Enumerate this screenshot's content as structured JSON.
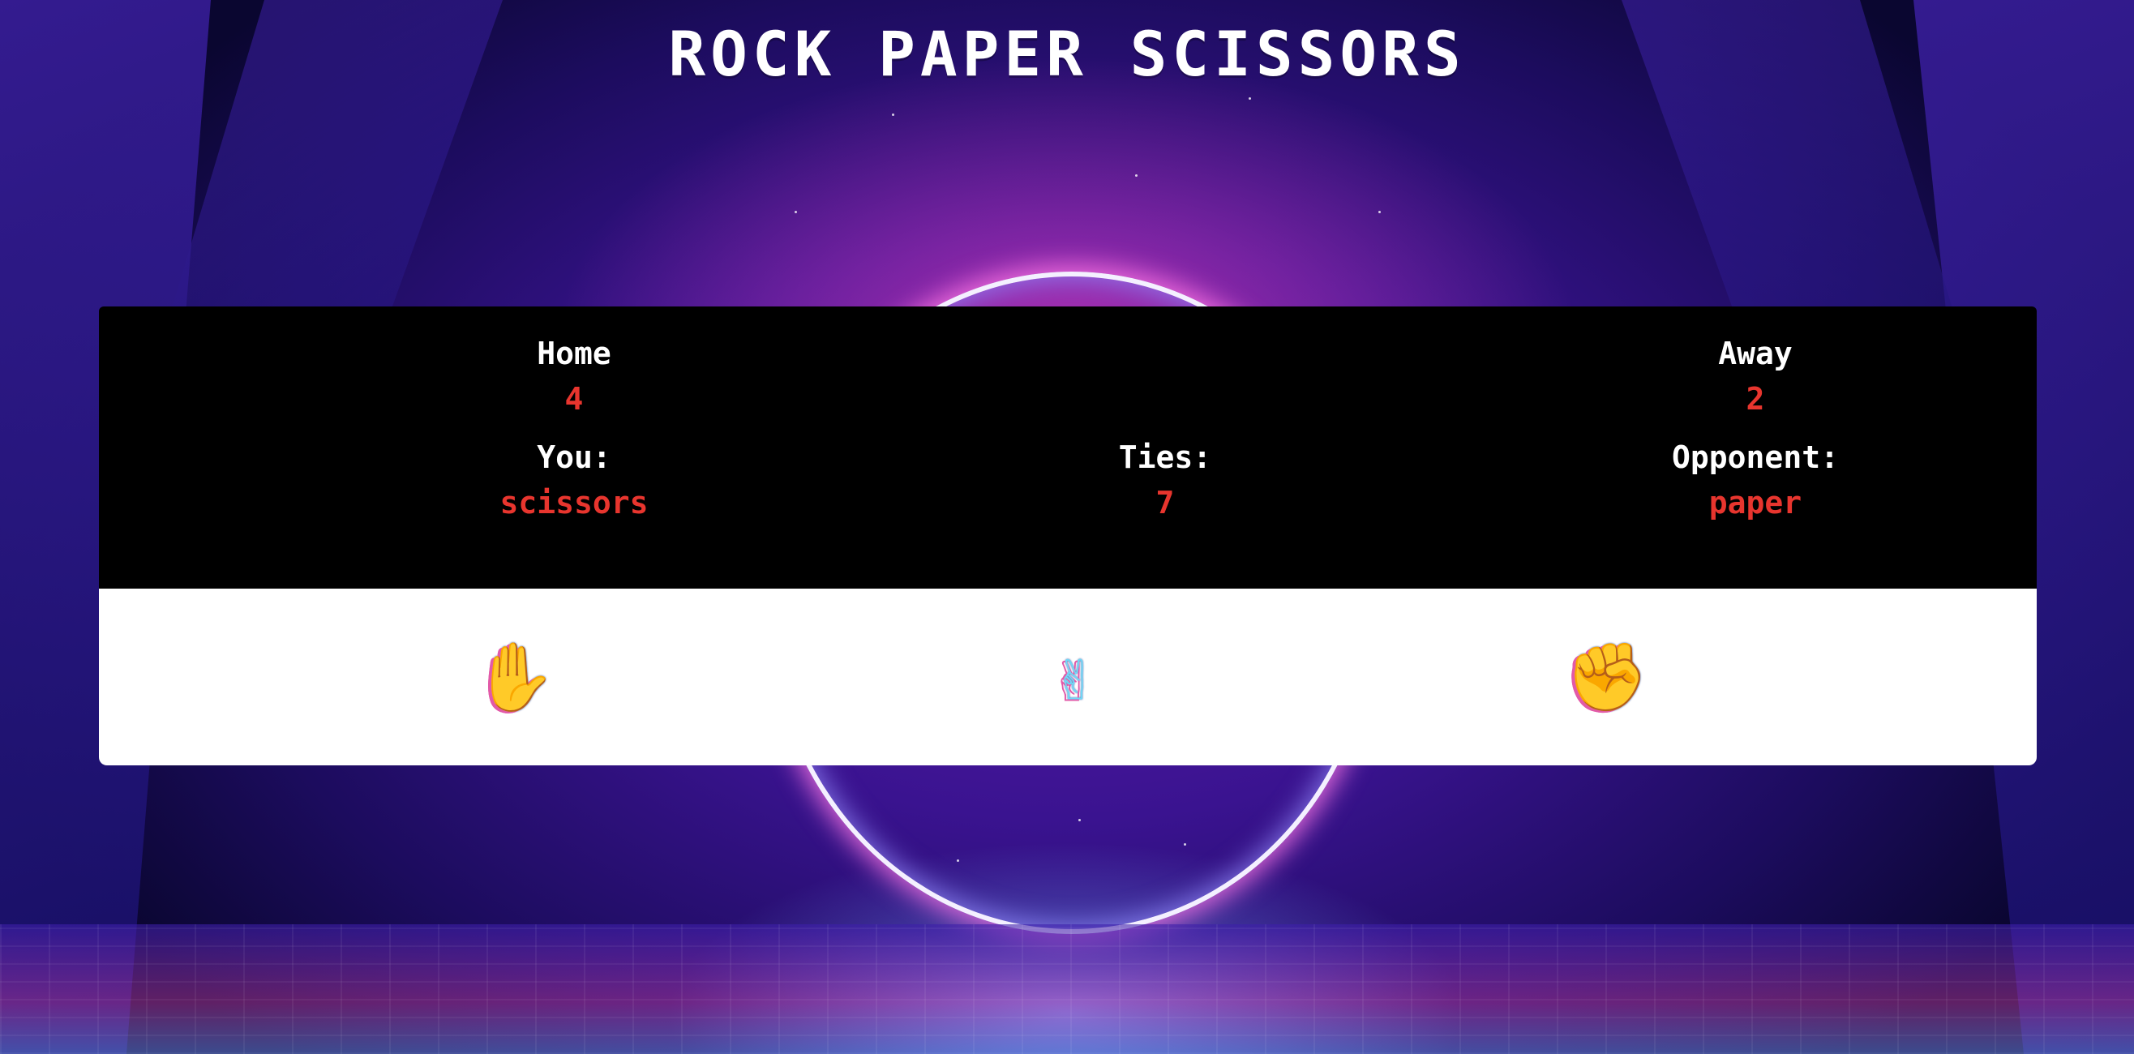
{
  "title": "ROCK PAPER SCISSORS",
  "scoreboard": {
    "home": {
      "label": "Home",
      "score": "4"
    },
    "away": {
      "label": "Away",
      "score": "2"
    },
    "you": {
      "label": "You:",
      "choice": "scissors"
    },
    "ties": {
      "label": "Ties:",
      "count": "7"
    },
    "opponent": {
      "label": "Opponent:",
      "choice": "paper"
    }
  },
  "choices": [
    {
      "name": "paper",
      "icon": "raised-hand-icon",
      "glyph": "✋"
    },
    {
      "name": "scissors",
      "icon": "victory-hand-icon",
      "glyph": "✌"
    },
    {
      "name": "rock",
      "icon": "raised-fist-icon",
      "glyph": "✊"
    }
  ],
  "colors": {
    "value_red": "#e8352e",
    "panel_black": "#000000",
    "panel_white": "#ffffff",
    "hand_cyan": "#6fd8f7",
    "hand_pink": "#e25aa8"
  }
}
